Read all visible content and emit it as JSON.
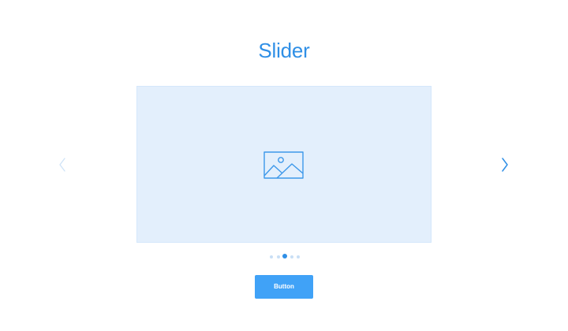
{
  "title": "Slider",
  "colors": {
    "accent": "#2f8fe6",
    "slide_bg": "#e3effc",
    "icon": "#3d98ea",
    "arrow_prev": "#cfe3f7",
    "arrow_next": "#2f8fe6",
    "dot_inactive": "#c9dff5",
    "dot_active": "#2f8fe6",
    "button_bg": "#40a2f7"
  },
  "slider": {
    "slide_icon": "image-placeholder-icon",
    "prev_icon": "chevron-left-icon",
    "next_icon": "chevron-right-icon",
    "slide_count": 5,
    "active_index": 2
  },
  "button": {
    "label": "Button"
  }
}
